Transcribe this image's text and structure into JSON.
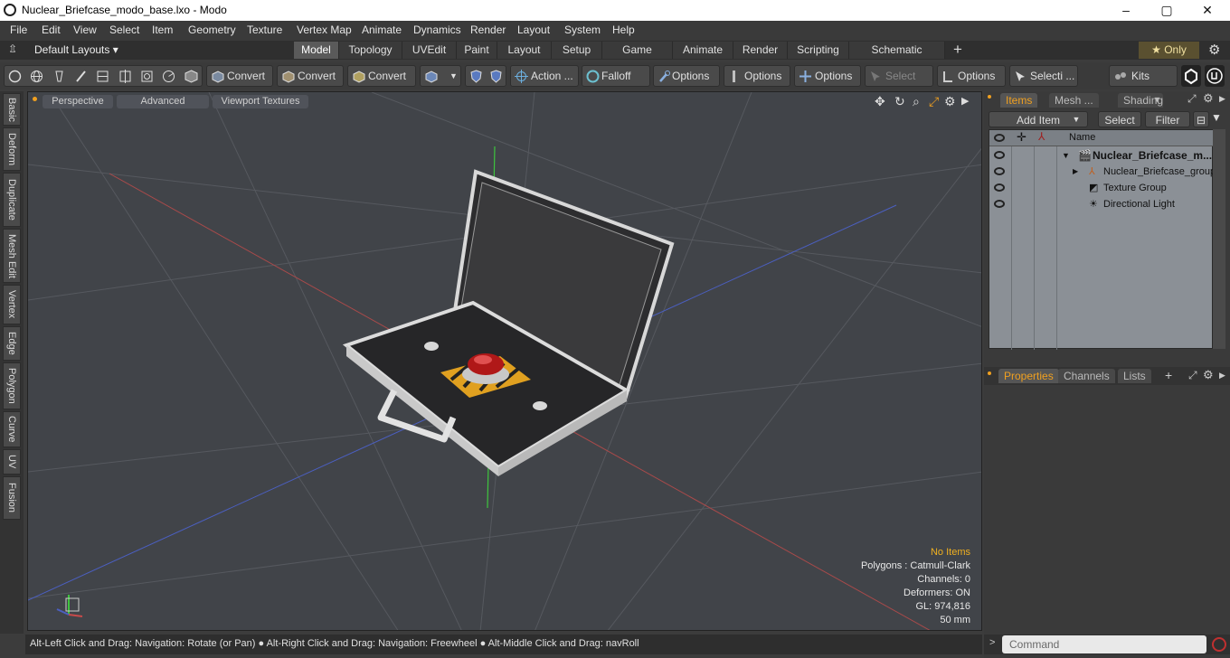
{
  "titlebar": {
    "title": "Nuclear_Briefcase_modo_base.lxo - Modo",
    "minimize": "‒",
    "maximize": "▢",
    "close": "✕"
  },
  "menu": [
    "File",
    "Edit",
    "View",
    "Select",
    "Item",
    "Geometry",
    "Texture",
    "Vertex Map",
    "Animate",
    "Dynamics",
    "Render",
    "Layout",
    "System",
    "Help"
  ],
  "layoutbar": {
    "layouts_label": "Default Layouts ▾",
    "tabs": [
      "Model",
      "Topology",
      "UVEdit",
      "Paint",
      "Layout",
      "Setup",
      "Game Tools",
      "Animate",
      "Render",
      "Scripting",
      "Schematic Fusion"
    ],
    "active_tab": "Model",
    "add": "+",
    "only": "★  Only"
  },
  "toolbar": {
    "convert1": "Convert",
    "convert2": "Convert",
    "convert3": "Convert",
    "action": "Action  ...",
    "falloff": "Falloff",
    "options1": "Options",
    "options2": "Options",
    "options3": "Options",
    "select_t": "Select T...",
    "options4": "Options",
    "selecti": "Selecti ...",
    "kits": "Kits"
  },
  "left_tabs": [
    "Basic",
    "Deform",
    "Duplicate",
    "Mesh Edit",
    "Vertex",
    "Edge",
    "Polygon",
    "Curve",
    "UV",
    "Fusion"
  ],
  "viewport": {
    "perspective": "Perspective",
    "advanced": "Advanced",
    "textures": "Viewport Textures",
    "stats": {
      "no_items": "No Items",
      "polygons": "Polygons : Catmull-Clark",
      "channels": "Channels: 0",
      "deformers": "Deformers: ON",
      "gl": "GL: 974,816",
      "mm": "50 mm"
    }
  },
  "status": "Alt-Left Click and Drag: Navigation: Rotate (or Pan) ● Alt-Right Click and Drag: Navigation: Freewheel ● Alt-Middle Click and Drag: navRoll",
  "items_panel": {
    "tabs": [
      "Items",
      "Mesh ...",
      "Shading"
    ],
    "add_item": "Add Item",
    "select": "Select",
    "filter": "Filter",
    "name_header": "Name",
    "rows": [
      "Nuclear_Briefcase_m...",
      "Nuclear_Briefcase_group",
      "Texture Group",
      "Directional Light"
    ]
  },
  "props_panel": {
    "tabs": [
      "Properties",
      "Channels",
      "Lists"
    ],
    "add": "+"
  },
  "command": {
    "placeholder": "Command"
  },
  "colors": {
    "accent": "#f0a020",
    "viewport_bg": "#414449"
  }
}
